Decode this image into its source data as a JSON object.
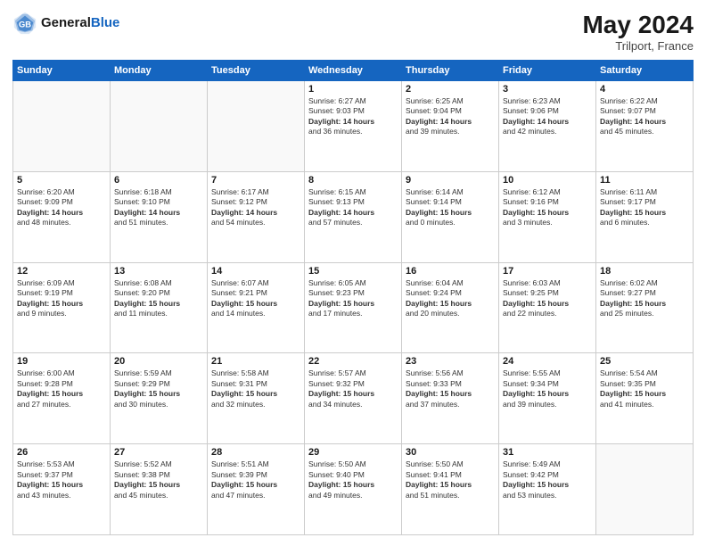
{
  "header": {
    "logo_line1": "General",
    "logo_line2": "Blue",
    "month_year": "May 2024",
    "location": "Trilport, France"
  },
  "days_of_week": [
    "Sunday",
    "Monday",
    "Tuesday",
    "Wednesday",
    "Thursday",
    "Friday",
    "Saturday"
  ],
  "weeks": [
    [
      {
        "day": "",
        "info": ""
      },
      {
        "day": "",
        "info": ""
      },
      {
        "day": "",
        "info": ""
      },
      {
        "day": "1",
        "info": "Sunrise: 6:27 AM\nSunset: 9:03 PM\nDaylight: 14 hours\nand 36 minutes."
      },
      {
        "day": "2",
        "info": "Sunrise: 6:25 AM\nSunset: 9:04 PM\nDaylight: 14 hours\nand 39 minutes."
      },
      {
        "day": "3",
        "info": "Sunrise: 6:23 AM\nSunset: 9:06 PM\nDaylight: 14 hours\nand 42 minutes."
      },
      {
        "day": "4",
        "info": "Sunrise: 6:22 AM\nSunset: 9:07 PM\nDaylight: 14 hours\nand 45 minutes."
      }
    ],
    [
      {
        "day": "5",
        "info": "Sunrise: 6:20 AM\nSunset: 9:09 PM\nDaylight: 14 hours\nand 48 minutes."
      },
      {
        "day": "6",
        "info": "Sunrise: 6:18 AM\nSunset: 9:10 PM\nDaylight: 14 hours\nand 51 minutes."
      },
      {
        "day": "7",
        "info": "Sunrise: 6:17 AM\nSunset: 9:12 PM\nDaylight: 14 hours\nand 54 minutes."
      },
      {
        "day": "8",
        "info": "Sunrise: 6:15 AM\nSunset: 9:13 PM\nDaylight: 14 hours\nand 57 minutes."
      },
      {
        "day": "9",
        "info": "Sunrise: 6:14 AM\nSunset: 9:14 PM\nDaylight: 15 hours\nand 0 minutes."
      },
      {
        "day": "10",
        "info": "Sunrise: 6:12 AM\nSunset: 9:16 PM\nDaylight: 15 hours\nand 3 minutes."
      },
      {
        "day": "11",
        "info": "Sunrise: 6:11 AM\nSunset: 9:17 PM\nDaylight: 15 hours\nand 6 minutes."
      }
    ],
    [
      {
        "day": "12",
        "info": "Sunrise: 6:09 AM\nSunset: 9:19 PM\nDaylight: 15 hours\nand 9 minutes."
      },
      {
        "day": "13",
        "info": "Sunrise: 6:08 AM\nSunset: 9:20 PM\nDaylight: 15 hours\nand 11 minutes."
      },
      {
        "day": "14",
        "info": "Sunrise: 6:07 AM\nSunset: 9:21 PM\nDaylight: 15 hours\nand 14 minutes."
      },
      {
        "day": "15",
        "info": "Sunrise: 6:05 AM\nSunset: 9:23 PM\nDaylight: 15 hours\nand 17 minutes."
      },
      {
        "day": "16",
        "info": "Sunrise: 6:04 AM\nSunset: 9:24 PM\nDaylight: 15 hours\nand 20 minutes."
      },
      {
        "day": "17",
        "info": "Sunrise: 6:03 AM\nSunset: 9:25 PM\nDaylight: 15 hours\nand 22 minutes."
      },
      {
        "day": "18",
        "info": "Sunrise: 6:02 AM\nSunset: 9:27 PM\nDaylight: 15 hours\nand 25 minutes."
      }
    ],
    [
      {
        "day": "19",
        "info": "Sunrise: 6:00 AM\nSunset: 9:28 PM\nDaylight: 15 hours\nand 27 minutes."
      },
      {
        "day": "20",
        "info": "Sunrise: 5:59 AM\nSunset: 9:29 PM\nDaylight: 15 hours\nand 30 minutes."
      },
      {
        "day": "21",
        "info": "Sunrise: 5:58 AM\nSunset: 9:31 PM\nDaylight: 15 hours\nand 32 minutes."
      },
      {
        "day": "22",
        "info": "Sunrise: 5:57 AM\nSunset: 9:32 PM\nDaylight: 15 hours\nand 34 minutes."
      },
      {
        "day": "23",
        "info": "Sunrise: 5:56 AM\nSunset: 9:33 PM\nDaylight: 15 hours\nand 37 minutes."
      },
      {
        "day": "24",
        "info": "Sunrise: 5:55 AM\nSunset: 9:34 PM\nDaylight: 15 hours\nand 39 minutes."
      },
      {
        "day": "25",
        "info": "Sunrise: 5:54 AM\nSunset: 9:35 PM\nDaylight: 15 hours\nand 41 minutes."
      }
    ],
    [
      {
        "day": "26",
        "info": "Sunrise: 5:53 AM\nSunset: 9:37 PM\nDaylight: 15 hours\nand 43 minutes."
      },
      {
        "day": "27",
        "info": "Sunrise: 5:52 AM\nSunset: 9:38 PM\nDaylight: 15 hours\nand 45 minutes."
      },
      {
        "day": "28",
        "info": "Sunrise: 5:51 AM\nSunset: 9:39 PM\nDaylight: 15 hours\nand 47 minutes."
      },
      {
        "day": "29",
        "info": "Sunrise: 5:50 AM\nSunset: 9:40 PM\nDaylight: 15 hours\nand 49 minutes."
      },
      {
        "day": "30",
        "info": "Sunrise: 5:50 AM\nSunset: 9:41 PM\nDaylight: 15 hours\nand 51 minutes."
      },
      {
        "day": "31",
        "info": "Sunrise: 5:49 AM\nSunset: 9:42 PM\nDaylight: 15 hours\nand 53 minutes."
      },
      {
        "day": "",
        "info": ""
      }
    ]
  ]
}
